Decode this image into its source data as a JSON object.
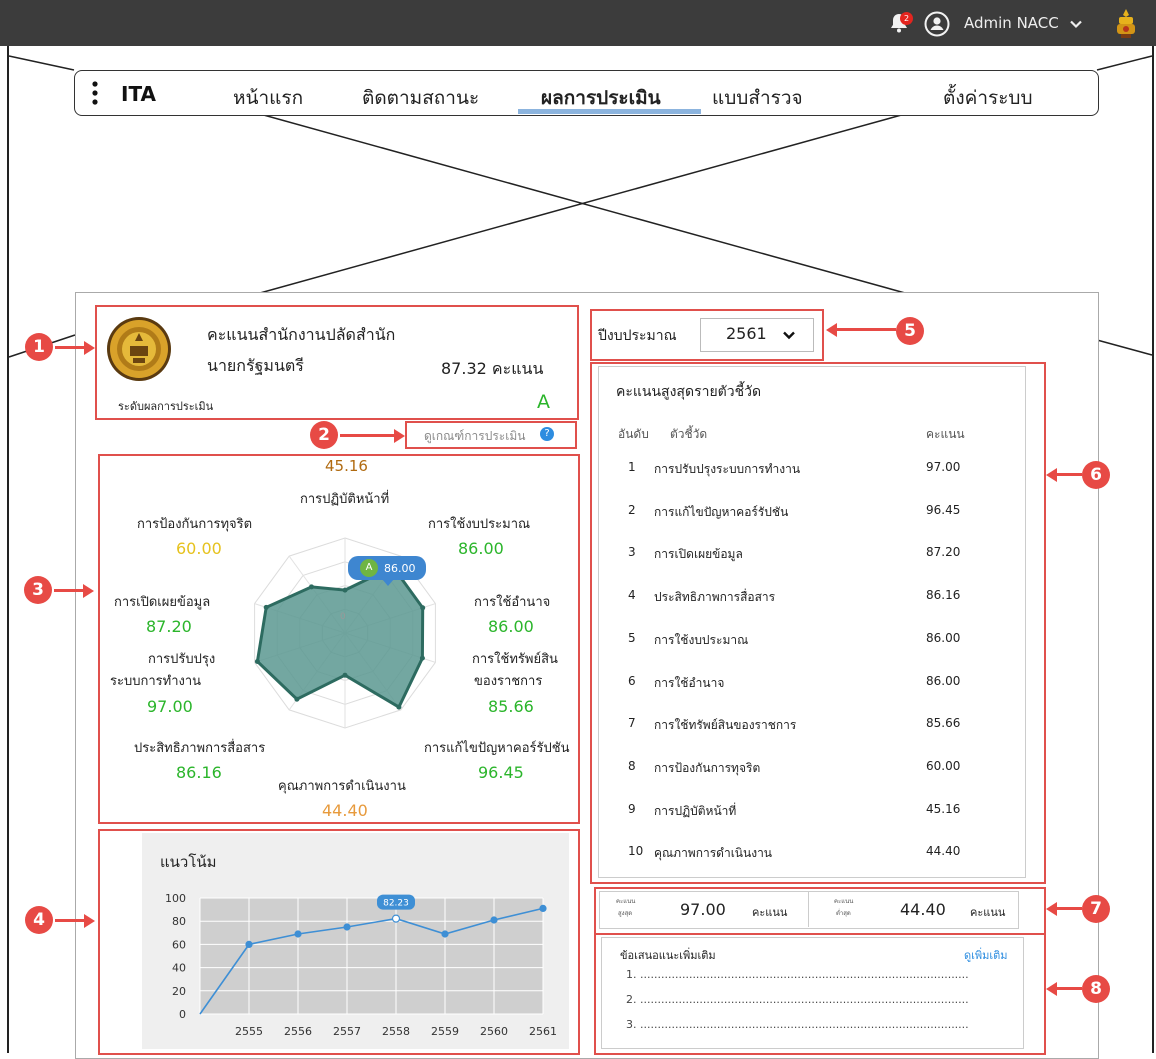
{
  "header": {
    "notification_count": "2",
    "user_name": "Admin NACC"
  },
  "nav": {
    "brand": "ITA",
    "items": [
      "หน้าแรก",
      "ติดตามสถานะ",
      "ผลการประเมิน",
      "แบบสำรวจ",
      "ตั้งค่าระบบ"
    ],
    "active_index": 2
  },
  "score_card": {
    "title_line1": "คะแนนสำนักงานปลัดสำนัก",
    "title_line2": "นายกรัฐมนตรี",
    "score": "87.32 คะแนน",
    "level_label": "ระดับผลการประเมิน",
    "level": "A"
  },
  "criteria_link": "ดูเกณฑ์การประเมิน",
  "radar": {
    "tooltip_badge": "A",
    "tooltip_value": "86.00",
    "center_value": "0",
    "axes": [
      {
        "label": "การปฏิบัติหน้าที่",
        "value_text": "45.16"
      },
      {
        "label": "การใช้งบประมาณ",
        "value_text": "86.00"
      },
      {
        "label": "การใช้อำนาจ",
        "value_text": "86.00"
      },
      {
        "label_line1": "การใช้ทรัพย์สิน",
        "label_line2": "ของราชการ",
        "value_text": "85.66"
      },
      {
        "label": "การแก้ไขปัญหาคอร์รัปชัน",
        "value_text": "96.45"
      },
      {
        "label": "คุณภาพการดำเนินงาน",
        "value_text": "44.40"
      },
      {
        "label": "ประสิทธิภาพการสื่อสาร",
        "value_text": "86.16"
      },
      {
        "label_line1": "การปรับปรุง",
        "label_line2": "ระบบการทำงาน",
        "value_text": "97.00"
      },
      {
        "label": "การเปิดเผยข้อมูล",
        "value_text": "87.20"
      },
      {
        "label": "การป้องกันการทุจริต",
        "value_text": "60.00"
      }
    ],
    "values": [
      45.16,
      86.0,
      86.0,
      85.66,
      96.45,
      44.4,
      86.16,
      97.0,
      87.2,
      60.0
    ],
    "colors": {
      "fill": "#5b9890",
      "stroke": "#2d6b60",
      "green": "#2bb52b",
      "orange": "#e79a3c",
      "yellow": "#e6c21e"
    }
  },
  "chart_data": {
    "type": "line",
    "title": "แนวโน้ม",
    "x": [
      "",
      "2555",
      "2556",
      "2557",
      "2558",
      "2559",
      "2560",
      "2561"
    ],
    "values": [
      0,
      60,
      69,
      75,
      82.23,
      69,
      81,
      91
    ],
    "ylim": [
      0,
      100
    ],
    "yticks": [
      "100",
      "80",
      "60",
      "40",
      "20",
      "0"
    ],
    "tooltip": "82.23",
    "grid": true,
    "colors": {
      "line": "#3e8fd5",
      "plot_bg": "#cfcfcf"
    }
  },
  "year_select": {
    "label": "ปีงบประมาณ",
    "value": "2561"
  },
  "ranking": {
    "title": "คะแนนสูงสุดรายตัวชี้วัด",
    "columns": [
      "อันดับ",
      "ตัวชี้วัด",
      "คะแนน"
    ],
    "rows": [
      [
        "1",
        "การปรับปรุงระบบการทำงาน",
        "97.00"
      ],
      [
        "2",
        "การแก้ไขปัญหาคอร์รัปชัน",
        "96.45"
      ],
      [
        "3",
        "การเปิดเผยข้อมูล",
        "87.20"
      ],
      [
        "4",
        "ประสิทธิภาพการสื่อสาร",
        "86.16"
      ],
      [
        "5",
        "การใช้งบประมาณ",
        "86.00"
      ],
      [
        "6",
        "การใช้อำนาจ",
        "86.00"
      ],
      [
        "7",
        "การใช้ทรัพย์สินของราชการ",
        "85.66"
      ],
      [
        "8",
        "การป้องกันการทุจริต",
        "60.00"
      ],
      [
        "9",
        "การปฏิบัติหน้าที่",
        "45.16"
      ],
      [
        "10",
        "คุณภาพการดำเนินงาน",
        "44.40"
      ]
    ]
  },
  "summary": {
    "max_label_1": "คะแนน",
    "max_label_2": "สูงสุด",
    "max_value": "97.00",
    "max_unit": "คะแนน",
    "min_label_1": "คะแนน",
    "min_label_2": "ต่ำสุด",
    "min_value": "44.40",
    "min_unit": "คะแนน"
  },
  "suggestions": {
    "title": "ข้อเสนอแนะเพิ่มเติม",
    "more_link": "ดูเพิ่มเติม",
    "lines": [
      "1. ..............................................................................................",
      "2. ..............................................................................................",
      "3. .............................................................................................."
    ]
  },
  "callouts": [
    "1",
    "2",
    "3",
    "4",
    "5",
    "6",
    "7",
    "8"
  ]
}
